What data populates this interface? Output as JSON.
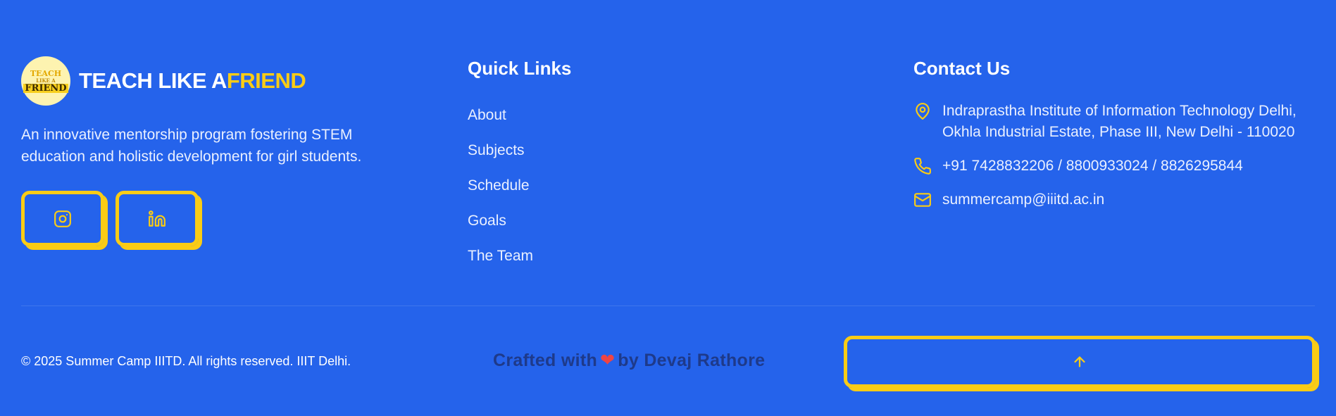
{
  "brand": {
    "logo_text": [
      "TEACH",
      "LIKE A",
      "FRIEND"
    ],
    "title_main": "TEACH LIKE A",
    "title_accent": "FRIEND",
    "tagline": "An innovative mentorship program fostering STEM education and holistic development for girl students."
  },
  "socials": [
    {
      "icon": "instagram-icon"
    },
    {
      "icon": "linkedin-icon"
    }
  ],
  "quick_links": {
    "title": "Quick Links",
    "items": [
      "About",
      "Subjects",
      "Schedule",
      "Goals",
      "The Team"
    ]
  },
  "contact": {
    "title": "Contact Us",
    "address": "Indraprastha Institute of Information Technology Delhi, Okhla Industrial Estate, Phase III, New Delhi - 110020",
    "phone": "+91 7428832206 / 8800933024 / 8826295844",
    "email": "summercamp@iiitd.ac.in"
  },
  "bottom": {
    "copyright": "© 2025 Summer Camp IIITD. All rights reserved. IIIT Delhi.",
    "crafted_prefix": "Crafted with",
    "crafted_suffix": "by Devaj Rathore",
    "heart": "❤"
  },
  "colors": {
    "background": "#2563eb",
    "accent": "#facc15",
    "heart": "#ef4444",
    "crafted_text": "#1e3a8a"
  }
}
